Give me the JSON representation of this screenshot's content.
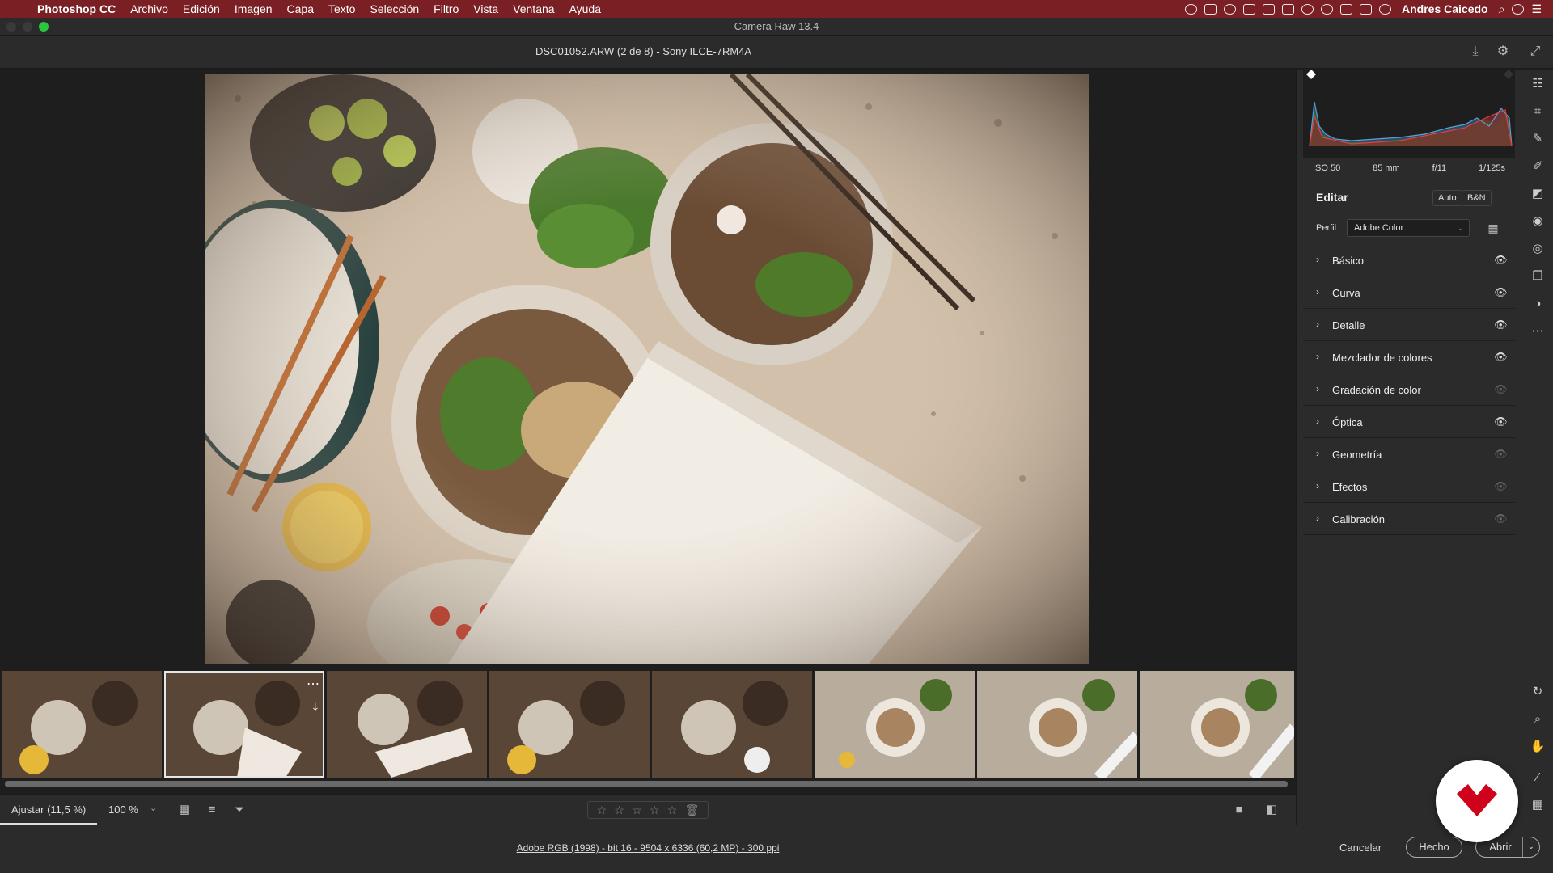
{
  "menubar": {
    "app_name": "Photoshop CC",
    "items": [
      "Archivo",
      "Edición",
      "Imagen",
      "Capa",
      "Texto",
      "Selección",
      "Filtro",
      "Vista",
      "Ventana",
      "Ayuda"
    ],
    "user_name": "Andres Caicedo"
  },
  "window": {
    "title": "Camera Raw 13.4"
  },
  "header": {
    "file_title": "DSC01052.ARW (2 de 8) -  Sony ILCE-7RM4A"
  },
  "exif": {
    "iso": "ISO 50",
    "focal_length": "85 mm",
    "aperture": "f/11",
    "shutter": "1/125s"
  },
  "edit": {
    "title": "Editar",
    "auto_label": "Auto",
    "bw_label": "B&N",
    "profile_label": "Perfil",
    "profile_value": "Adobe Color",
    "sections": [
      {
        "label": "Básico",
        "visible": true
      },
      {
        "label": "Curva",
        "visible": true
      },
      {
        "label": "Detalle",
        "visible": true
      },
      {
        "label": "Mezclador de colores",
        "visible": true
      },
      {
        "label": "Gradación de color",
        "visible": false
      },
      {
        "label": "Óptica",
        "visible": true
      },
      {
        "label": "Geometría",
        "visible": false
      },
      {
        "label": "Efectos",
        "visible": false
      },
      {
        "label": "Calibración",
        "visible": false
      }
    ]
  },
  "filmstrip": {
    "count": 8,
    "selected_index": 1
  },
  "toolbar": {
    "zoom_fit": "Ajustar (11,5 %)",
    "zoom_percent": "100 %",
    "rating_stars": 0
  },
  "footer": {
    "info_link": "Adobe RGB (1998) - bit 16 - 9504 x 6336 (60,2 MP) - 300 ppi",
    "cancel_label": "Cancelar",
    "done_label": "Hecho",
    "open_label": "Abrir"
  },
  "colors": {
    "menubar_bg": "#7a1f24",
    "panel_bg": "#2b2b2b",
    "canvas_bg": "#1e1e1e",
    "badge_red": "#d0021b"
  },
  "icons": {
    "toolstrip": [
      "edit-sliders-icon",
      "crop-icon",
      "healing-icon",
      "brush-icon",
      "gradient-icon",
      "radial-icon",
      "red-eye-icon",
      "snapshots-icon",
      "presets-icon",
      "more-icon",
      "rotate-icon",
      "zoom-icon",
      "hand-icon",
      "sampler-icon",
      "grid-overlay-icon"
    ]
  }
}
